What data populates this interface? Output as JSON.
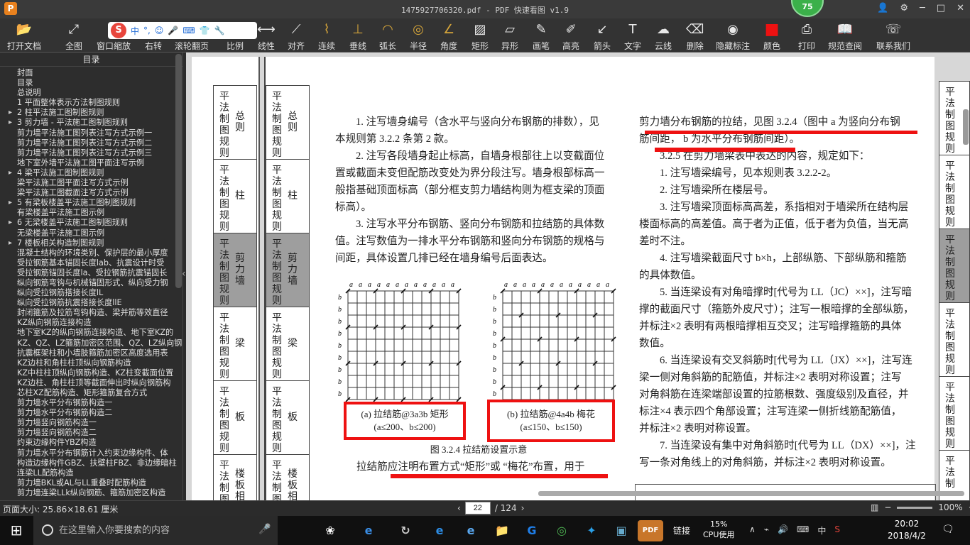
{
  "window": {
    "title": "1475927706320.pdf - PDF 快速看图 v1.9",
    "logo_letter": "P",
    "badge_count": "75"
  },
  "toolbar": {
    "items": [
      {
        "label": "打开文档",
        "icon": "📂"
      },
      {
        "label": "全图",
        "icon": "⤢"
      },
      {
        "label": "窗口缩放",
        "icon": "🔍"
      },
      {
        "label": "右转",
        "icon": "↻"
      },
      {
        "label": "滚轮翻页",
        "icon": "⇕"
      },
      {
        "label": "比例",
        "icon": "↔"
      },
      {
        "label": "线性",
        "icon": "⟷"
      },
      {
        "label": "对齐",
        "icon": "⟋"
      },
      {
        "label": "连续",
        "icon": "⌇"
      },
      {
        "label": "垂线",
        "icon": "⊥"
      },
      {
        "label": "弧长",
        "icon": "◠"
      },
      {
        "label": "半径",
        "icon": "◎"
      },
      {
        "label": "角度",
        "icon": "∠"
      },
      {
        "label": "矩形",
        "icon": "▨"
      },
      {
        "label": "异形",
        "icon": "▱"
      },
      {
        "label": "画笔",
        "icon": "✎"
      },
      {
        "label": "高亮",
        "icon": "✐"
      },
      {
        "label": "箭头",
        "icon": "↙"
      },
      {
        "label": "文字",
        "icon": "T"
      },
      {
        "label": "云线",
        "icon": "☁"
      },
      {
        "label": "删除",
        "icon": "⌫"
      },
      {
        "label": "隐藏标注",
        "icon": "◉"
      },
      {
        "label": "颜色",
        "icon": "■"
      },
      {
        "label": "打印",
        "icon": "⎙"
      },
      {
        "label": "规范查阅",
        "icon": "📖"
      },
      {
        "label": "联系我们",
        "icon": "☏"
      }
    ],
    "color_swatch": "#ee1111"
  },
  "ime": {
    "logo": "S",
    "lang": "中",
    "punct": "°,",
    "emoji": "☺",
    "voice": "🎤",
    "keyboard": "⌨",
    "skin": "👕",
    "tools": "🔧"
  },
  "sidebar": {
    "title": "目录",
    "items": [
      {
        "t": "封面",
        "lvl": 0,
        "arrow": false
      },
      {
        "t": "目录",
        "lvl": 0,
        "arrow": false
      },
      {
        "t": "总说明",
        "lvl": 0,
        "arrow": false
      },
      {
        "t": "1 平面整体表示方法制图规则",
        "lvl": 0,
        "arrow": false
      },
      {
        "t": "2 柱平法施工图制图规则",
        "lvl": 0,
        "arrow": true
      },
      {
        "t": "3 剪力墙 - 平法施工图制图规则",
        "lvl": 0,
        "arrow": true
      },
      {
        "t": "剪力墙平法施工图列表注写方式示例一",
        "lvl": 1,
        "arrow": false
      },
      {
        "t": "剪力墙平法施工图列表注写方式示例二",
        "lvl": 1,
        "arrow": false
      },
      {
        "t": "剪力墙平法施工图列表注写方式示例三",
        "lvl": 1,
        "arrow": false
      },
      {
        "t": "地下室外墙平法施工图平面注写示例",
        "lvl": 1,
        "arrow": false
      },
      {
        "t": "4 梁平法施工图制图规则",
        "lvl": 0,
        "arrow": true
      },
      {
        "t": "梁平法施工图平面注写方式示例",
        "lvl": 1,
        "arrow": false
      },
      {
        "t": "梁平法施工图截面注写方式示例",
        "lvl": 1,
        "arrow": false
      },
      {
        "t": "5 有梁板楼盖平法施工图制图规则",
        "lvl": 0,
        "arrow": true
      },
      {
        "t": "有梁楼盖平法施工图示例",
        "lvl": 1,
        "arrow": false
      },
      {
        "t": "6 无梁楼盖平法施工图制图规则",
        "lvl": 0,
        "arrow": true
      },
      {
        "t": "无梁楼盖平法施工图示例",
        "lvl": 1,
        "arrow": false
      },
      {
        "t": "7 楼板相关构造制图规则",
        "lvl": 0,
        "arrow": true
      },
      {
        "t": "混凝土结构的环境类别、保护层的最小厚度",
        "lvl": 1,
        "arrow": false
      },
      {
        "t": "受拉钢筋基本锚固长度lab、抗震设计时受",
        "lvl": 1,
        "arrow": false
      },
      {
        "t": "受拉钢筋锚固长度la、受拉钢筋抗震锚固长",
        "lvl": 1,
        "arrow": false
      },
      {
        "t": "纵向钢筋弯钩与机械锚固形式、纵向受力钢",
        "lvl": 1,
        "arrow": false
      },
      {
        "t": "纵向受拉钢筋搭接长度lL",
        "lvl": 1,
        "arrow": false
      },
      {
        "t": "纵向受拉钢筋抗震搭接长度llE",
        "lvl": 1,
        "arrow": false
      },
      {
        "t": "封闭箍筋及拉筋弯钩构造、梁并筋等效直径",
        "lvl": 1,
        "arrow": false
      },
      {
        "t": "KZ纵向钢筋连接构造",
        "lvl": 1,
        "arrow": false
      },
      {
        "t": "地下室KZ的纵向钢筋连接构造、地下室KZ的",
        "lvl": 1,
        "arrow": false
      },
      {
        "t": "KZ、QZ、LZ箍筋加密区范围、QZ、LZ纵向钢",
        "lvl": 1,
        "arrow": false
      },
      {
        "t": "抗震框架柱和小墙肢箍筋加密区高度选用表",
        "lvl": 1,
        "arrow": false
      },
      {
        "t": "KZ边柱和角柱柱顶纵向钢筋构造",
        "lvl": 1,
        "arrow": false
      },
      {
        "t": "KZ中柱柱顶纵向钢筋构造、KZ柱变截面位置",
        "lvl": 1,
        "arrow": false
      },
      {
        "t": "KZ边柱、角柱柱顶等截面伸出时纵向钢筋构",
        "lvl": 1,
        "arrow": false
      },
      {
        "t": "芯柱XZ配筋构造、矩形箍筋复合方式",
        "lvl": 1,
        "arrow": false
      },
      {
        "t": "剪力墙水平分布钢筋构造一",
        "lvl": 1,
        "arrow": false
      },
      {
        "t": "剪力墙水平分布钢筋构造二",
        "lvl": 1,
        "arrow": false
      },
      {
        "t": "剪力墙竖向钢筋构造一",
        "lvl": 1,
        "arrow": false
      },
      {
        "t": "剪力墙竖向钢筋构造二",
        "lvl": 1,
        "arrow": false
      },
      {
        "t": "约束边缘构件YBZ构造",
        "lvl": 1,
        "arrow": false
      },
      {
        "t": "剪力墙水平分布钢筋计入约束边缘构件、体",
        "lvl": 1,
        "arrow": false
      },
      {
        "t": "构造边缘构件GBZ、扶壁柱FBZ、非边缘暗柱",
        "lvl": 1,
        "arrow": false
      },
      {
        "t": "连梁LL配筋构造",
        "lvl": 1,
        "arrow": false
      },
      {
        "t": "剪力墙BKL或AL与LL重叠时配筋构造",
        "lvl": 1,
        "arrow": false
      },
      {
        "t": "剪力墙连梁LLk纵向钢筋、箍筋加密区构造",
        "lvl": 1,
        "arrow": false
      }
    ]
  },
  "page": {
    "left_tabs": [
      {
        "v": "平法制图规则",
        "s": "总则",
        "gray": false
      },
      {
        "v": "平法制图规则",
        "s": "柱",
        "gray": false
      },
      {
        "v": "平法制图规则",
        "s": "剪力墙",
        "gray": true
      },
      {
        "v": "平法制图规则",
        "s": "梁",
        "gray": false
      },
      {
        "v": "平法制图规则",
        "s": "板",
        "gray": false
      },
      {
        "v": "平法制图规则",
        "s": "楼板相关",
        "gray": false
      }
    ],
    "right_tabs": [
      {
        "v": "平法制图规则",
        "gray": false
      },
      {
        "v": "平法制图规则",
        "gray": false
      },
      {
        "v": "平法制图规则",
        "gray": true
      },
      {
        "v": "平法制图规则",
        "gray": false
      },
      {
        "v": "平法制图规则",
        "gray": false
      },
      {
        "v": "平法制",
        "gray": false
      }
    ],
    "left_col": [
      "1. 注写墙身编号（含水平与竖向分布钢筋的排数），见",
      "本规则第 3.2.2 条第 2 款。",
      "2. 注写各段墙身起止标高，自墙身根部往上以变截面位",
      "置或截面未变但配筋改变处为界分段注写。墙身根部标高一",
      "般指基础顶面标高（部分框支剪力墙结构则为框支梁的顶面",
      "标高）。",
      "3. 注写水平分布钢筋、竖向分布钢筋和拉结筋的具体数",
      "值。注写数值为一排水平分布钢筋和竖向分布钢筋的规格与",
      "间距，具体设置几排已经在墙身编号后面表达。"
    ],
    "fig_a_caption_1": "(a) 拉结筋@3a3b 矩形",
    "fig_a_caption_2": "(a≤200、b≤200)",
    "fig_b_caption_1": "(b) 拉结筋@4a4b 梅花",
    "fig_b_caption_2": "(a≤150、b≤150)",
    "fig_title": "图 3.2.4 拉结筋设置示意",
    "grid_top_label": "a",
    "grid_side_label": "b",
    "bottom_line": "拉结筋应注明布置方式“矩形”或 “梅花”布置，用于",
    "right_col": [
      "剪力墙分布钢筋的拉结，见图 3.2.4（图中 a 为竖向分布钢",
      "筋间距，  b 为水平分布钢筋间距）。",
      "3.2.5  在剪力墙梁表中表达的内容，规定如下：",
      "1. 注写墙梁编号，见本规则表 3.2.2-2。",
      "2. 注写墙梁所在楼层号。",
      "3. 注写墙梁顶面标高高差，系指相对于墙梁所在结构层",
      "楼面标高的高差值。高于者为正值，低于者为负值，当无高",
      "差时不注。",
      "4. 注写墙梁截面尺寸 b×h，上部纵筋、下部纵筋和箍筋",
      "的具体数值。",
      "5. 当连梁设有对角暗撑时[代号为 LL（JC）××]，注写暗",
      "撑的截面尺寸（箍筋外皮尺寸）；注写一根暗撑的全部纵筋，",
      "并标注×2 表明有两根暗撑相互交叉；注写暗撑箍筋的具体",
      "数值。",
      "6. 当连梁设有交叉斜筋时[代号为 LL（JX）××]，注写连",
      "梁一侧对角斜筋的配筋值，并标注×2 表明对称设置；注写",
      "对角斜筋在连梁端部设置的拉筋根数、强度级别及直径，并",
      "标注×4 表示四个角部设置；注写连梁一侧折线筋配筋值，",
      "并标注×2 表明对称设置。",
      "7. 当连梁设有集中对角斜筋时[代号为 LL（DX）××]，注",
      "写一条对角线上的对角斜筋，并标注×2 表明对称设置。"
    ]
  },
  "status": {
    "page_size": "页面大小: 25.86×18.61 厘米",
    "current_page": "22",
    "total": "/ 124",
    "zoom": "100%",
    "prev": "‹",
    "next": "›",
    "minus": "−",
    "plus": "+"
  },
  "taskbar": {
    "search_placeholder": "在这里输入你要搜索的内容",
    "cpu_pct": "15%",
    "cpu_label": "CPU使用",
    "link_label": "链接",
    "ime_lang": "中",
    "time": "20:02",
    "date": "2018/4/2",
    "notif_count": "1"
  }
}
